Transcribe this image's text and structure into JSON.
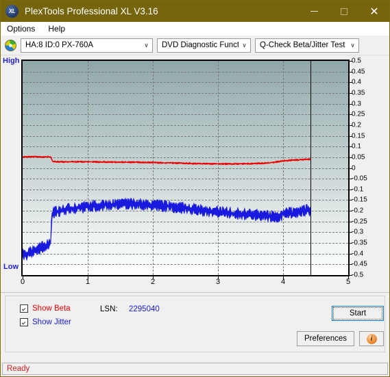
{
  "window": {
    "title": "PlexTools Professional XL V3.16",
    "logo_text": "XL",
    "minimize": "—",
    "maximize": "",
    "close": "✕"
  },
  "menu": {
    "items": [
      {
        "label": "Options",
        "accel": "O"
      },
      {
        "label": "Help",
        "accel": "H"
      }
    ]
  },
  "toolbar": {
    "drive_icon": "disc-icon",
    "drive_combo": "HA:8 ID:0  PX-760A",
    "function_combo": "DVD Diagnostic Functions",
    "test_combo": "Q-Check Beta/Jitter Test",
    "chevron": "∨"
  },
  "chart_data": {
    "type": "line",
    "title": "Q-Check Beta/Jitter Test",
    "xlabel": "",
    "ylabel": "",
    "xlim": [
      0,
      5
    ],
    "ylim": [
      -0.5,
      0.5
    ],
    "xticks": [
      0,
      1,
      2,
      3,
      4,
      5
    ],
    "yticks": [
      0.5,
      0.45,
      0.4,
      0.35,
      0.3,
      0.25,
      0.2,
      0.15,
      0.1,
      0.05,
      0,
      -0.05,
      -0.1,
      -0.15,
      -0.2,
      -0.25,
      -0.3,
      -0.35,
      -0.4,
      -0.45,
      -0.5
    ],
    "ytick_labels": [
      "0.5",
      "0.45",
      "0.4",
      "0.35",
      "0.3",
      "0.25",
      "0.2",
      "0.15",
      "0.1",
      "0.05",
      "0",
      "-0.05",
      "-0.1",
      "-0.15",
      "-0.2",
      "-0.25",
      "-0.3",
      "-0.35",
      "-0.4",
      "-0.45",
      "-0.5"
    ],
    "axis_top_label": "High",
    "axis_bottom_label": "Low",
    "grid": true,
    "grid_style": "dashed",
    "legend_position": "below-chart",
    "data_end_marker_x": 4.42,
    "series": [
      {
        "name": "Beta",
        "color": "#ee0000",
        "x": [
          0.0,
          0.1,
          0.2,
          0.3,
          0.4,
          0.43,
          0.46,
          0.5,
          0.7,
          1.0,
          1.3,
          1.6,
          1.9,
          2.2,
          2.5,
          2.8,
          3.1,
          3.3,
          3.5,
          3.7,
          3.85,
          4.0,
          4.1,
          4.2,
          4.3,
          4.42
        ],
        "values": [
          0.052,
          0.052,
          0.053,
          0.052,
          0.052,
          0.052,
          0.03,
          0.029,
          0.029,
          0.029,
          0.028,
          0.027,
          0.026,
          0.024,
          0.022,
          0.02,
          0.019,
          0.019,
          0.02,
          0.022,
          0.026,
          0.033,
          0.036,
          0.037,
          0.039,
          0.041
        ],
        "noise": 0.004
      },
      {
        "name": "Jitter",
        "color": "#1a1adf",
        "x": [
          0.0,
          0.05,
          0.1,
          0.15,
          0.2,
          0.25,
          0.3,
          0.35,
          0.4,
          0.43,
          0.45,
          0.5,
          0.6,
          0.75,
          0.9,
          1.05,
          1.2,
          1.35,
          1.5,
          1.65,
          1.8,
          2.0,
          2.2,
          2.4,
          2.6,
          2.8,
          3.0,
          3.2,
          3.4,
          3.6,
          3.8,
          3.95,
          4.05,
          4.15,
          4.25,
          4.35,
          4.42
        ],
        "values": [
          -0.4,
          -0.405,
          -0.395,
          -0.392,
          -0.385,
          -0.378,
          -0.37,
          -0.362,
          -0.355,
          -0.35,
          -0.215,
          -0.205,
          -0.198,
          -0.19,
          -0.185,
          -0.18,
          -0.176,
          -0.172,
          -0.17,
          -0.168,
          -0.168,
          -0.172,
          -0.178,
          -0.185,
          -0.192,
          -0.2,
          -0.206,
          -0.212,
          -0.216,
          -0.22,
          -0.224,
          -0.226,
          -0.205,
          -0.212,
          -0.2,
          -0.196,
          -0.2
        ],
        "noise": 0.028
      }
    ]
  },
  "controls": {
    "show_beta": {
      "label": "Show Beta",
      "accel": "B",
      "checked": true,
      "color": "#ee0000"
    },
    "show_jitter": {
      "label": "Show Jitter",
      "accel": "J",
      "checked": true,
      "color": "#1a1adf"
    },
    "lsn_label": "LSN:",
    "lsn_value": "2295040",
    "start_button": "Start",
    "preferences_button": "Preferences",
    "info_button": "i"
  },
  "status": {
    "text": "Ready"
  }
}
